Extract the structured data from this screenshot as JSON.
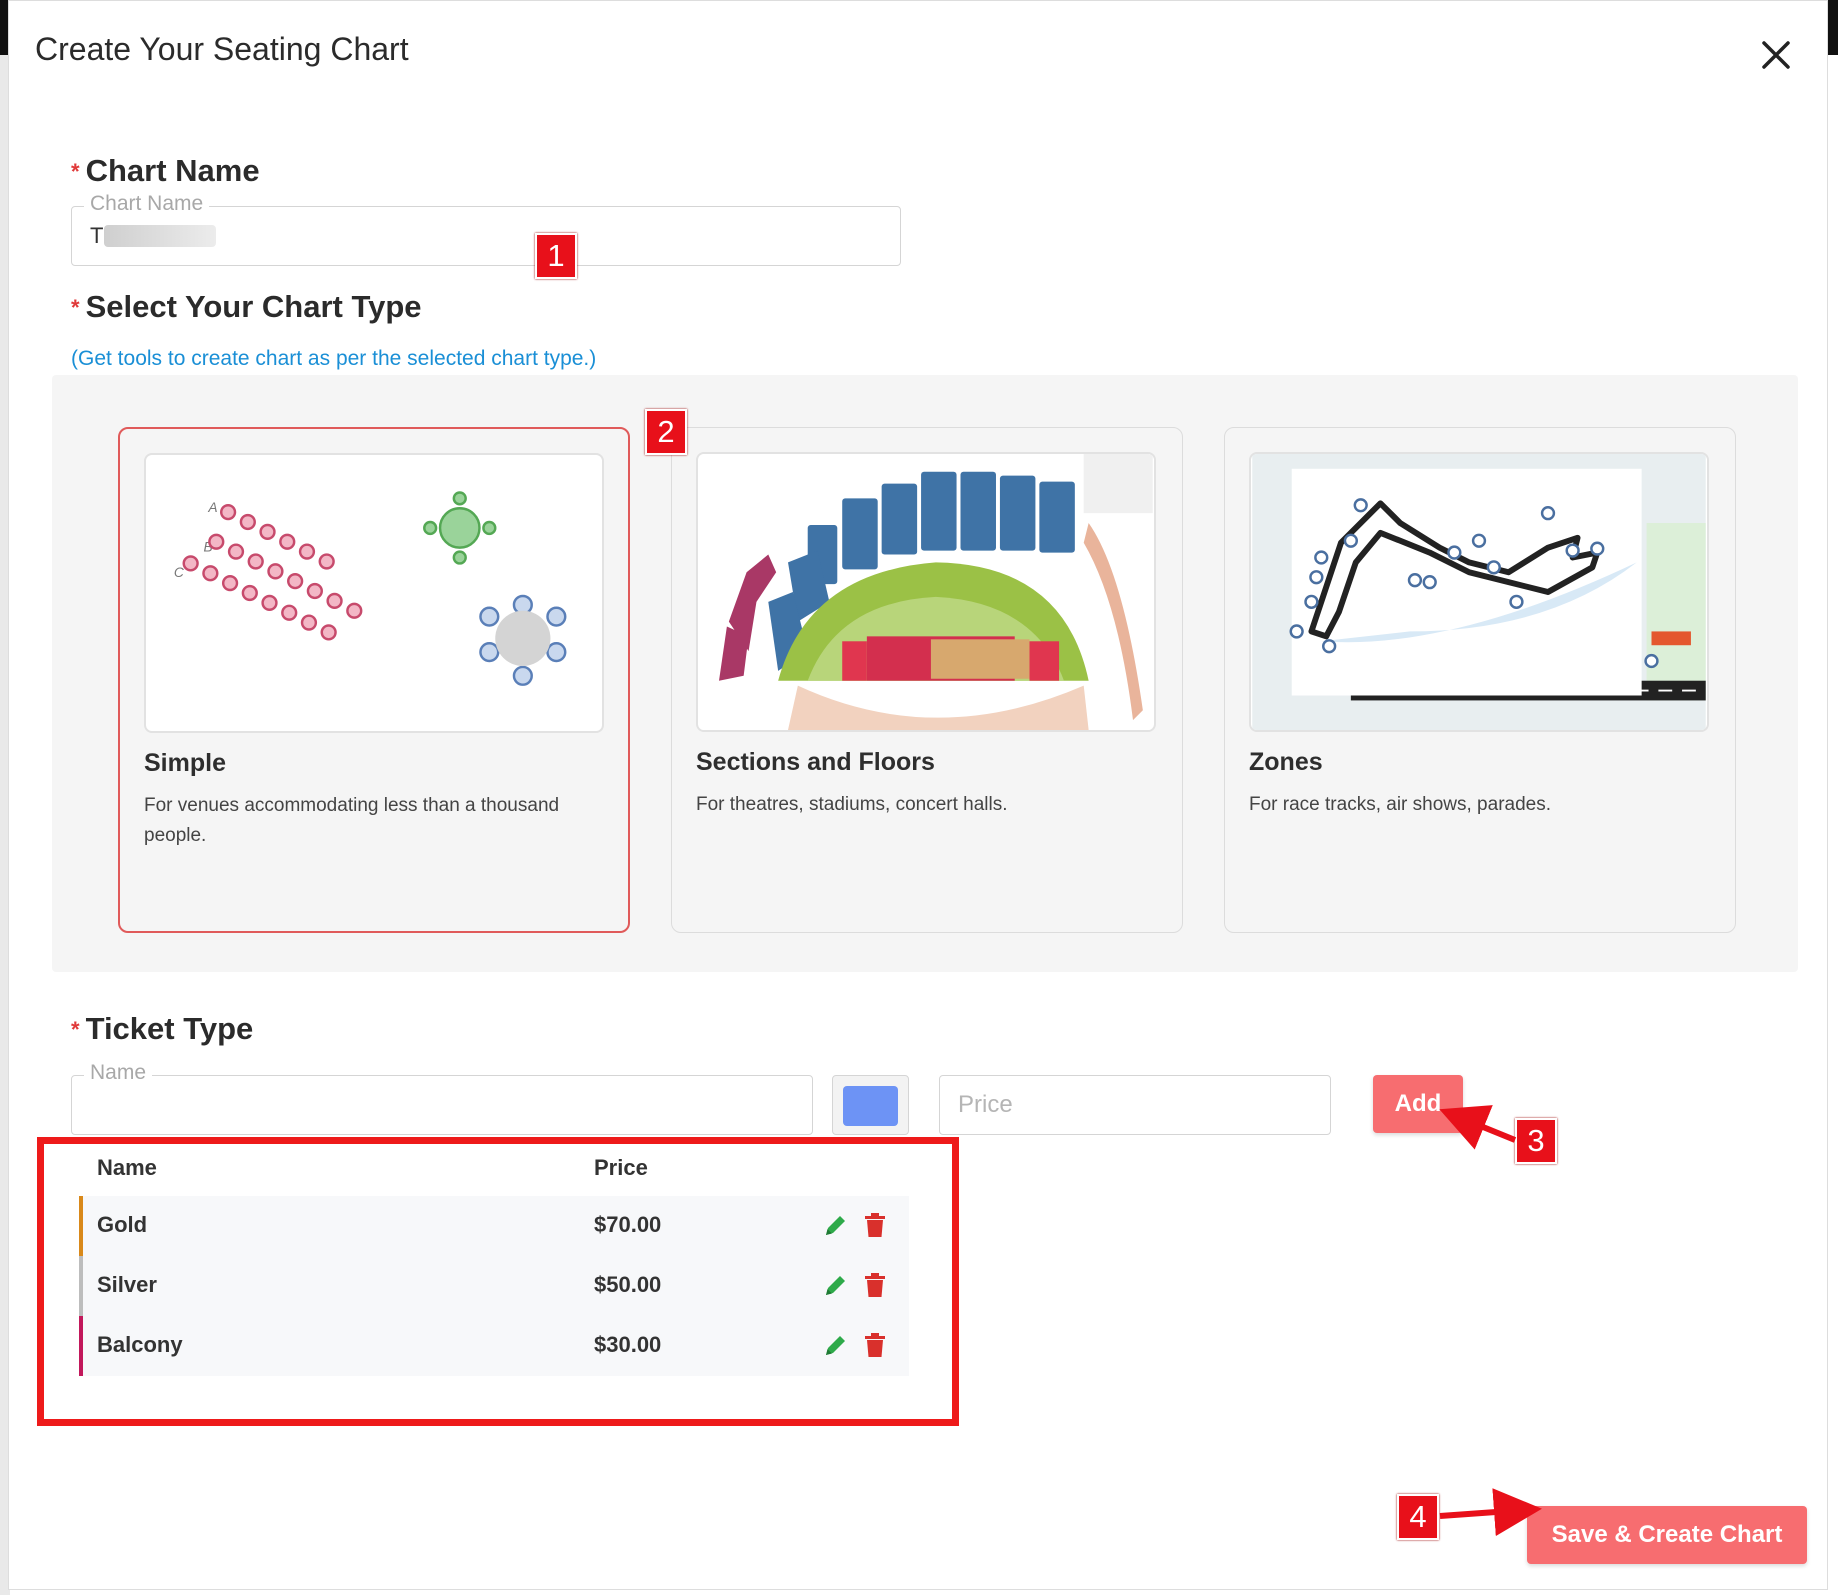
{
  "modal": {
    "title": "Create Your Seating Chart",
    "close_icon": "close-icon"
  },
  "chart_name": {
    "section_label": "Chart Name",
    "required_mark": "*",
    "field_label": "Chart Name",
    "value": "T"
  },
  "chart_type": {
    "section_label": "Select Your Chart Type",
    "required_mark": "*",
    "hint": "(Get tools to create chart as per the selected chart type.)",
    "selected": "Simple",
    "options": [
      {
        "title": "Simple",
        "description": "For venues accommodating less than a thousand people."
      },
      {
        "title": "Sections and Floors",
        "description": "For theatres, stadiums, concert halls."
      },
      {
        "title": "Zones",
        "description": "For race tracks, air shows, parades."
      }
    ]
  },
  "ticket_type": {
    "section_label": "Ticket Type",
    "required_mark": "*",
    "name_label": "Name",
    "price_placeholder": "Price",
    "selected_color": "#6d93f5",
    "add_button": "Add",
    "columns": {
      "name": "Name",
      "price": "Price"
    },
    "rows": [
      {
        "name": "Gold",
        "price": "$70.00",
        "color": "#d9891a"
      },
      {
        "name": "Silver",
        "price": "$50.00",
        "color": "#bdbdbd"
      },
      {
        "name": "Balcony",
        "price": "$30.00",
        "color": "#c2185b"
      }
    ]
  },
  "footer": {
    "save_button": "Save & Create Chart"
  },
  "annotations": {
    "m1": "1",
    "m2": "2",
    "m3": "3",
    "m4": "4"
  },
  "colors": {
    "accent": "#f76d70",
    "link": "#1a8fd6",
    "annotation_red": "#e8101a"
  }
}
